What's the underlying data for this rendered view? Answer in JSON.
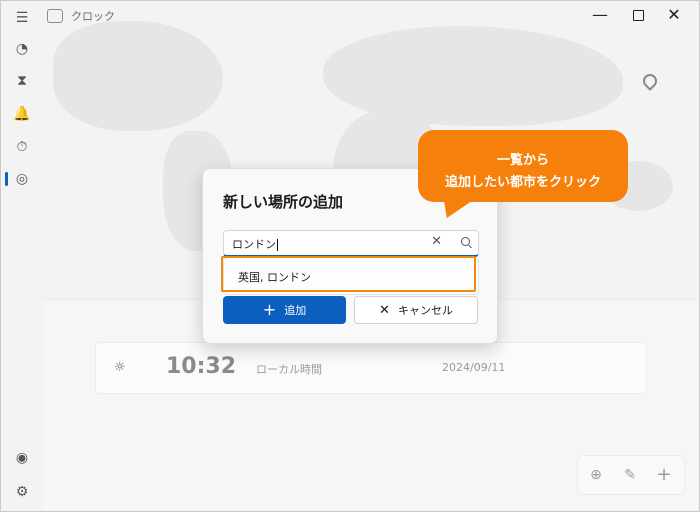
{
  "window": {
    "title": "クロック",
    "minimize": "—",
    "close": "✕"
  },
  "sidebar": {
    "menu_icon": "☰",
    "items": [
      {
        "name": "focus-icon",
        "glyph": "◔"
      },
      {
        "name": "timer-icon",
        "glyph": "⧗"
      },
      {
        "name": "alarm-icon",
        "glyph": "🔔"
      },
      {
        "name": "stopwatch-icon",
        "glyph": "⏱"
      },
      {
        "name": "world-clock-icon",
        "glyph": "◎"
      }
    ],
    "account_icon": "◉",
    "settings_icon": "⚙"
  },
  "clock_card": {
    "time": "10:32",
    "label": "ローカル時間",
    "date": "2024/09/11",
    "sun_icon": "☼"
  },
  "bottom_actions": {
    "compare": "⊕",
    "edit": "✎",
    "add": "+"
  },
  "dialog": {
    "title": "新しい場所の追加",
    "search_value": "ロンドン",
    "clear_icon": "✕",
    "suggestion": "英国, ロンドン",
    "add_label": "追加",
    "add_icon": "+",
    "cancel_label": "キャンセル",
    "cancel_icon": "✕"
  },
  "callout": {
    "line1": "一覧から",
    "line2": "追加したい都市をクリック",
    "color": "#f5810c"
  },
  "colors": {
    "accent": "#0a5fbf",
    "highlight": "#f0890c"
  }
}
